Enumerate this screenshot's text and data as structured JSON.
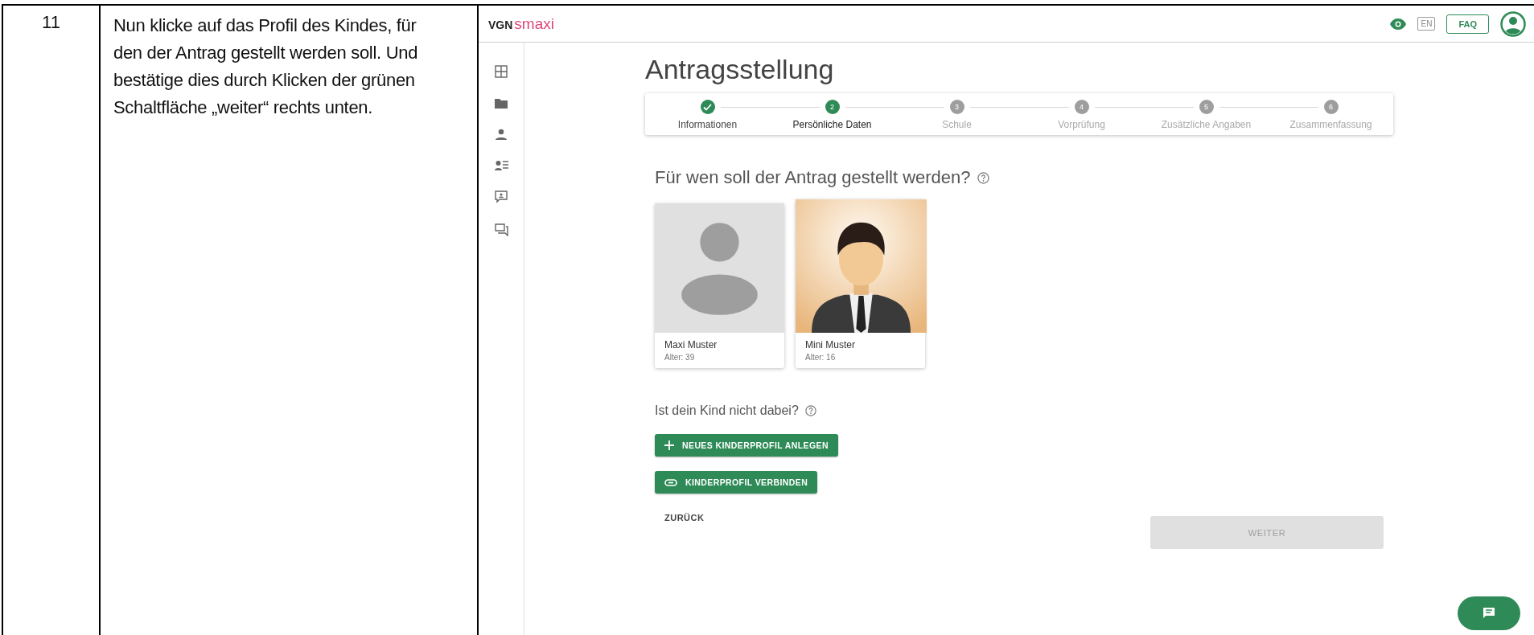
{
  "step_number": "11",
  "instruction": "Nun klicke auf das Profil des Kindes, für den der Antrag gestellt werden soll. Und bestätige dies durch Klicken der grünen Schaltfläche „weiter“ rechts unten.",
  "app": {
    "logo": {
      "brand": "VGN",
      "product": "smaxi"
    },
    "header": {
      "language": "EN",
      "faq": "FAQ"
    },
    "sidebar": {
      "items": [
        {
          "kind": "grid"
        },
        {
          "kind": "folder"
        },
        {
          "kind": "person"
        },
        {
          "kind": "person-list"
        },
        {
          "kind": "feedback"
        },
        {
          "kind": "chat"
        }
      ]
    },
    "title": "Antragsstellung",
    "steps": [
      {
        "label": "Informationen",
        "completed": true,
        "selected": false
      },
      {
        "marker": "2",
        "label": "Persönliche Daten",
        "completed": false,
        "selected": true
      },
      {
        "marker": "3",
        "label": "Schule",
        "completed": false,
        "selected": false
      },
      {
        "marker": "4",
        "label": "Vorprüfung",
        "completed": false,
        "selected": false
      },
      {
        "marker": "5",
        "label": "Zusätzliche Angaben",
        "completed": false,
        "selected": false
      },
      {
        "marker": "6",
        "label": "Zusammenfassung",
        "completed": false,
        "selected": false
      }
    ],
    "question": "Für wen soll der Antrag gestellt werden?",
    "profiles": [
      {
        "kind": "placeholder",
        "name": "Maxi Muster",
        "age": "Alter: 39"
      },
      {
        "kind": "picture",
        "name": "Mini Muster",
        "age": "Alter: 16"
      }
    ],
    "missing_question": "Ist dein Kind nicht dabei?",
    "actions": [
      {
        "kind": "add",
        "label": "NEUES KINDERPROFIL ANLEGEN"
      },
      {
        "kind": "link",
        "label": "KINDERPROFIL VERBINDEN"
      }
    ],
    "back": "ZURÜCK",
    "next": {
      "label": "WEITER",
      "disabled": true
    }
  }
}
